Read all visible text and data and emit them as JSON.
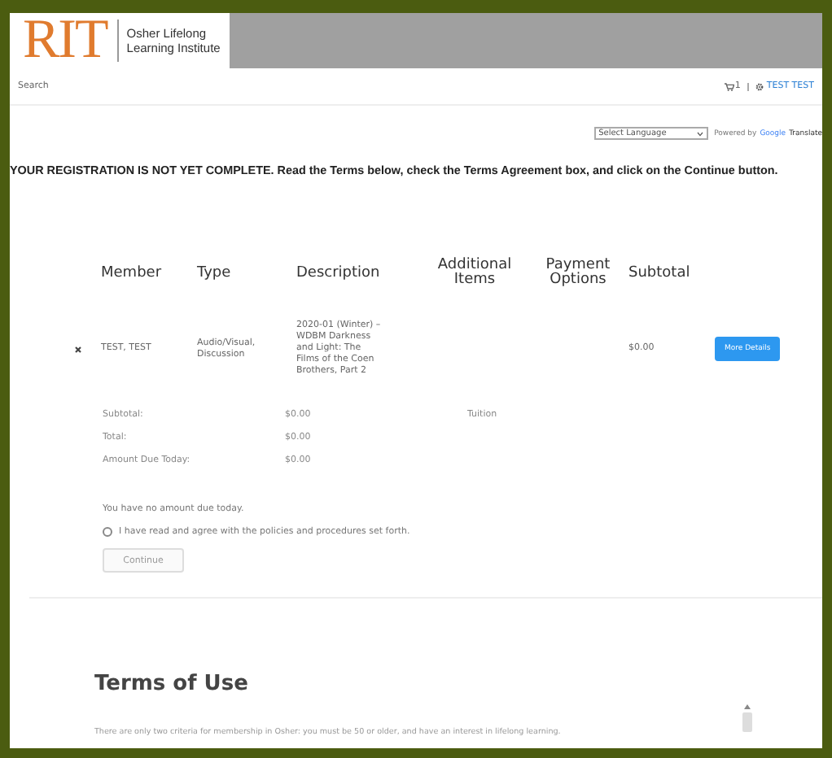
{
  "header": {
    "logo": "RIT",
    "institute": [
      "Osher Lifelong",
      "Learning Institute"
    ]
  },
  "nav": {
    "search": "Search",
    "cart_count": "1",
    "user": "TEST TEST"
  },
  "translate": {
    "select": "Select Language",
    "powered_by": "Powered by",
    "google": "Google",
    "translate": "Translate"
  },
  "notice": "YOUR REGISTRATION IS NOT YET COMPLETE. Read the Terms below, check the Terms Agreement box, and click on the Continue button.",
  "table": {
    "columns": [
      "Member",
      "Type",
      "Description",
      "Additional Items",
      "Payment Options",
      "Subtotal"
    ],
    "rows": [
      {
        "member": "TEST, TEST",
        "type": "Audio/Visual, Discussion",
        "description": "2020-01 (Winter) – WDBM Darkness and Light: The Films of the Coen Brothers, Part 2",
        "subtotal": "$0.00",
        "action": "More Details"
      }
    ]
  },
  "summary": [
    {
      "label": "Subtotal:",
      "value": "$0.00",
      "note": "Tuition"
    },
    {
      "label": "Total:",
      "value": "$0.00"
    },
    {
      "label": "Amount Due Today:",
      "value": "$0.00"
    }
  ],
  "due_message": "You have no amount due today.",
  "agree": {
    "label": "I have read and agree with the policies and procedures set forth.",
    "checked": false
  },
  "continue": {
    "label": "Continue",
    "disabled": true
  },
  "terms": {
    "title": "Terms of Use",
    "text": "There are only two criteria for membership in Osher: you must be 50 or older, and have an interest in lifelong learning."
  }
}
